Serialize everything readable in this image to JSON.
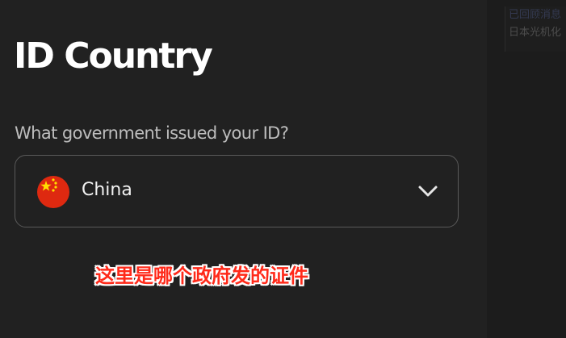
{
  "side_panel": {
    "line1": "已回顾消息",
    "line2": "日本光机化"
  },
  "page": {
    "title": "ID Country",
    "question": "What government issued your ID?"
  },
  "country_select": {
    "selected": "China",
    "flag_icon": "china-flag-icon",
    "dropdown_icon": "chevron-down-icon"
  },
  "caption": {
    "text": "这里是哪个政府发的证件",
    "color": "#ff2a1a"
  },
  "colors": {
    "background": "#212121",
    "flag_red": "#de2910",
    "flag_yellow": "#ffde00"
  }
}
